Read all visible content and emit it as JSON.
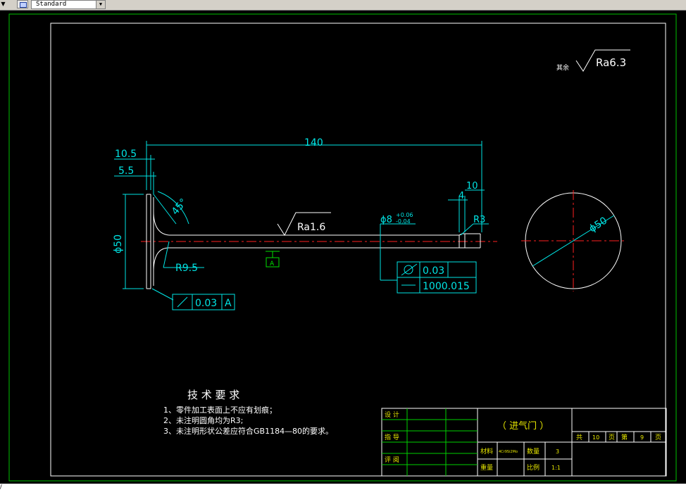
{
  "toolbar": {
    "style_value": "Standard"
  },
  "surface": {
    "other_label": "其余",
    "other_value": "Ra6.3",
    "shaft_value": "Ra1.6"
  },
  "dims": {
    "total_length": "140",
    "head_thick": "10.5",
    "head_step": "5.5",
    "head_dia": "ϕ50",
    "angle": "45°",
    "fillet": "R9.5",
    "end_len_1": "4",
    "end_len_2": "10",
    "end_radius": "R3",
    "stem_dia": "ϕ8",
    "tol_upper": "+0.06",
    "tol_lower": "-0.04",
    "circle_dia": "ϕ50"
  },
  "datum": {
    "label": "A"
  },
  "tolerance": {
    "runout_value": "0.03",
    "runout_datum": "A",
    "cyl_value": "0.03",
    "straight_value": "100\u00010.015"
  },
  "notes": {
    "title": "技 术 要 求",
    "items": [
      "1、零件加工表面上不应有划痕；",
      "2、未注明圆角均为R3;",
      "3、未注明形状公差应符合GB1184—80的要求。"
    ]
  },
  "title_block": {
    "design": "设 计",
    "guide": "指 导",
    "review": "评 阅",
    "part_name": "（ 进气门 ）",
    "material_label": "材料",
    "material_value": "4Cr9Si2Mo",
    "qty_label": "数量",
    "qty_value": "3",
    "weight_label": "重量",
    "scale_label": "比例",
    "scale_value": "1:1",
    "total_label": "共",
    "total_pages": "10",
    "page_label": "页",
    "no_label": "第",
    "page_no": "9",
    "page_label2": "页"
  },
  "status": {
    "text": "/"
  }
}
